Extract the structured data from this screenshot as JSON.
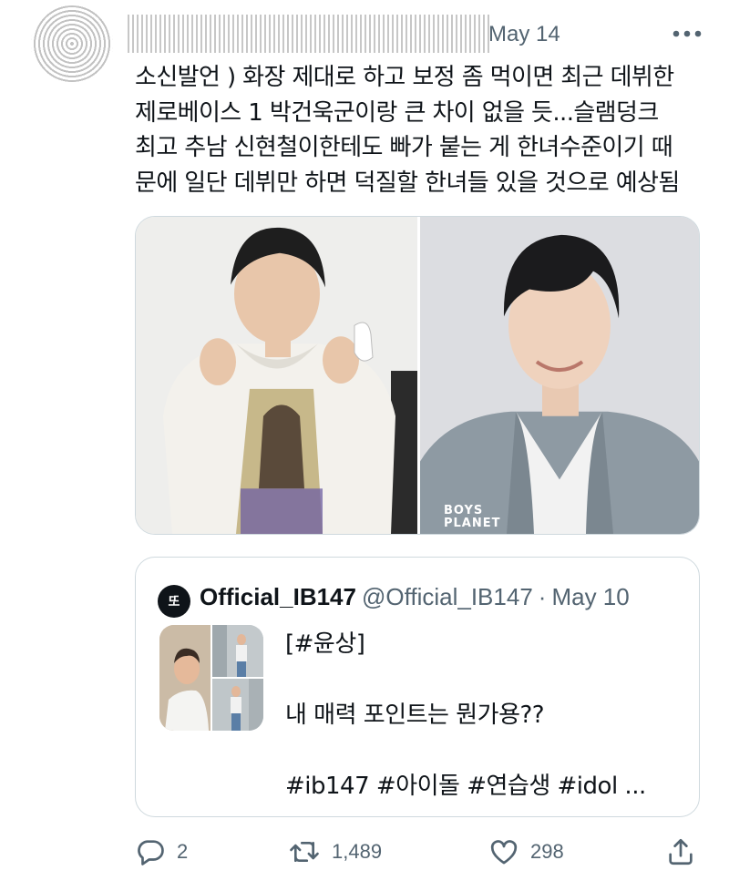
{
  "tweet": {
    "date": "May 14",
    "lines": [
      "소신발언 ) 화장 제대로 하고 보정 좀 먹이면 최근 데뷔한",
      "제로베이스 1 박건욱군이랑 큰 차이 없을 듯...슬램덩크",
      "최고 추남 신현철이한테도 빠가 붙는 게 한녀수준이기 때",
      "문에 일단 데뷔만 하면 덕질할 한녀들 있을 것으로 예상됨"
    ]
  },
  "media": {
    "right_photo_watermark_line1": "BOYS",
    "right_photo_watermark_line2": "PLANET"
  },
  "quote": {
    "avatar_glyph": "또",
    "name": "Official_IB147",
    "handle": "@Official_IB147",
    "separator": "·",
    "date": "May 10",
    "text_line1": "[#윤상]",
    "text_line2": "내 매력 포인트는 뭔가용??",
    "text_line3": "#ib147 #아이돌 #연습생 #idol ..."
  },
  "actions": {
    "replies": "2",
    "retweets": "1,489",
    "likes": "298"
  },
  "colors": {
    "text": "#0f1419",
    "secondary": "#536471",
    "border": "#cfd9de"
  }
}
